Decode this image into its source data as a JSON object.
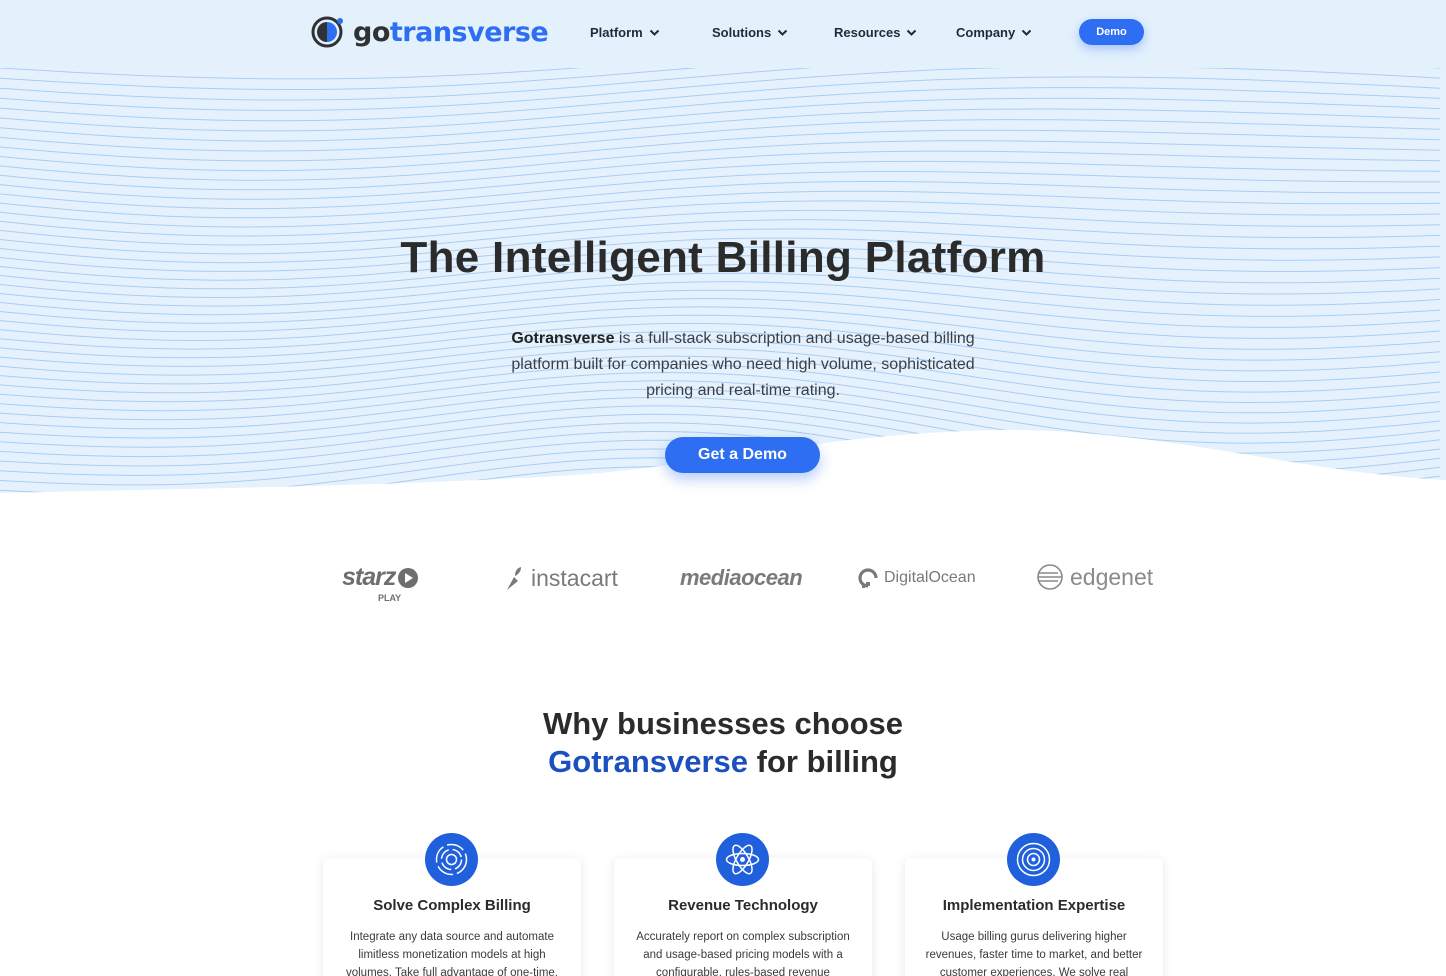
{
  "header": {
    "logo_go": "go",
    "logo_trans": "transverse",
    "nav": [
      "Platform",
      "Solutions",
      "Resources",
      "Company"
    ],
    "demo_label": "Demo"
  },
  "hero": {
    "title": "The Intelligent Billing Platform",
    "desc_bold": "Gotransverse",
    "desc_rest": " is a full-stack subscription and usage-based billing platform built for companies who need high volume, sophisticated pricing and real-time rating.",
    "cta_label": "Get a Demo"
  },
  "logos": {
    "starz": "starz",
    "starz_sub": "PLAY",
    "instacart": "instacart",
    "mediaocean": "mediaocean",
    "digitalocean": "DigitalOcean",
    "edgenet": "edgenet"
  },
  "why": {
    "line1": "Why businesses choose",
    "brand": "Gotransverse",
    "line2_rest": " for billing"
  },
  "cards": [
    {
      "icon": "target-rings-icon",
      "title": "Solve Complex Billing",
      "text": "Integrate any data source and automate limitless monetization models at high volumes. Take full advantage of one-time,"
    },
    {
      "icon": "atom-icon",
      "title": "Revenue Technology",
      "text": "Accurately report on complex subscription and usage-based pricing models with a configurable, rules-based revenue"
    },
    {
      "icon": "concentric-circles-icon",
      "title": "Implementation Expertise",
      "text": "Usage billing gurus delivering higher revenues, faster time to market, and better customer experiences. We solve real"
    }
  ],
  "colors": {
    "brand_blue": "#2e6ef2",
    "header_bg": "#e3f1fc",
    "dark_blue": "#1c4fbf"
  }
}
